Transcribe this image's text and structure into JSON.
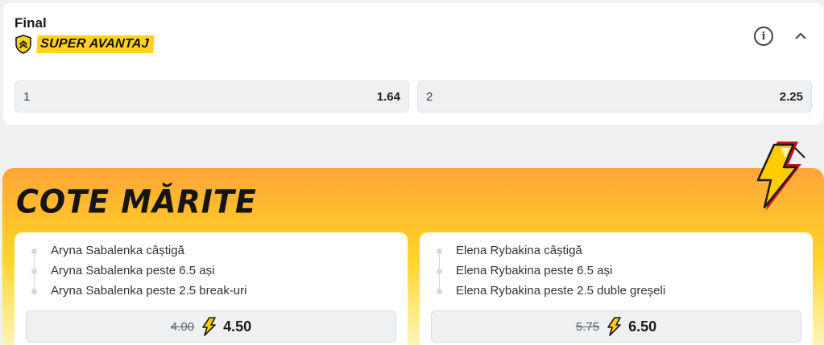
{
  "market": {
    "title": "Final",
    "badge_label": "SUPER AVANTAJ",
    "odds": [
      {
        "selection": "1",
        "value": "1.64"
      },
      {
        "selection": "2",
        "value": "2.25"
      }
    ]
  },
  "boost": {
    "title": "COTE MĂRITE",
    "cards": [
      {
        "legs": [
          "Aryna Sabalenka câștigă",
          "Aryna Sabalenka peste 6.5 ași",
          "Aryna Sabalenka peste 2.5 break-uri"
        ],
        "old_odds": "4.00",
        "new_odds": "4.50"
      },
      {
        "legs": [
          "Elena Rybakina câștigă",
          "Elena Rybakina peste 6.5 ași",
          "Elena Rybakina peste 2.5 duble greșeli"
        ],
        "old_odds": "5.75",
        "new_odds": "6.50"
      }
    ]
  },
  "icons": {
    "badge": "shield-chevron-icon",
    "info": "info-icon",
    "collapse": "chevron-up-icon",
    "boost_logo": "lightning-bolt-icon",
    "odds_bolt": "lightning-bolt-icon"
  },
  "colors": {
    "badge_yellow": "#ffd21f",
    "boost_orange": "#ffa53a",
    "boost_yellow": "#ffd528",
    "bolt_yellow": "#ffcc00"
  }
}
